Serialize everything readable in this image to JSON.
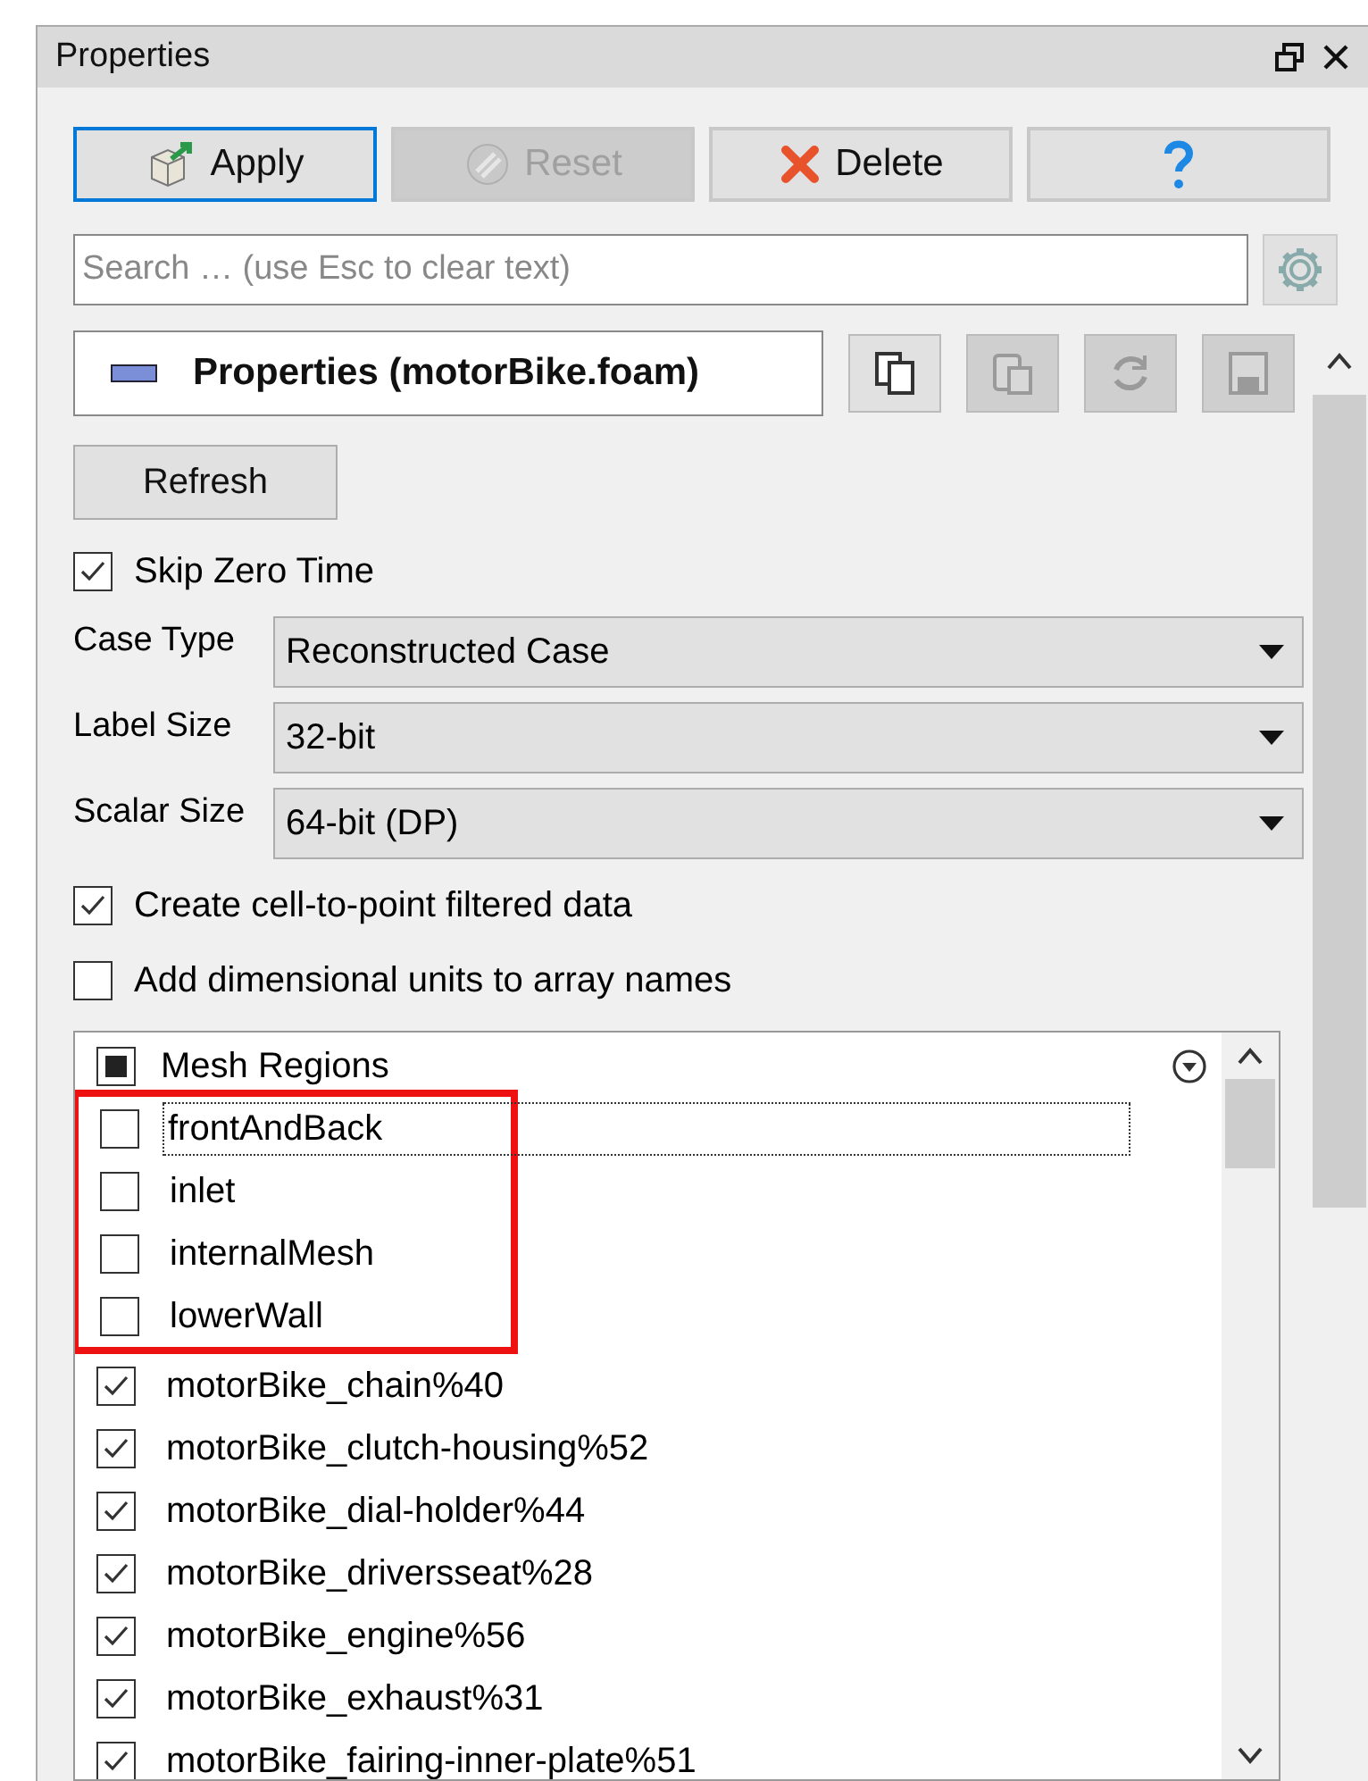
{
  "window": {
    "title": "Properties"
  },
  "actions": [
    {
      "kind": "apply",
      "label": "Apply",
      "disabled": false,
      "focused": true
    },
    {
      "kind": "reset",
      "label": "Reset",
      "disabled": true,
      "focused": false
    },
    {
      "kind": "delete",
      "label": "Delete",
      "disabled": false,
      "focused": false
    },
    {
      "kind": "help",
      "disabled": false,
      "focused": false
    }
  ],
  "search": {
    "placeholder": "Search … (use Esc to clear text)"
  },
  "section": {
    "title": "Properties (motorBike.foam)",
    "expanded": true
  },
  "tools": [
    {
      "kind": "copy",
      "disabled": false
    },
    {
      "kind": "paste",
      "disabled": true
    },
    {
      "kind": "reload",
      "disabled": true
    },
    {
      "kind": "save",
      "disabled": true
    }
  ],
  "refresh_button": "Refresh",
  "skip_zero_time": {
    "label": "Skip Zero Time",
    "checked": true
  },
  "dropdowns": [
    {
      "label": "Case Type",
      "value": "Reconstructed Case"
    },
    {
      "label": "Label Size",
      "value": "32-bit"
    },
    {
      "label": "Scalar Size",
      "value": "64-bit (DP)"
    }
  ],
  "options": [
    {
      "label": "Create cell-to-point filtered data",
      "checked": true
    },
    {
      "label": "Add dimensional units to array names",
      "checked": false
    }
  ],
  "mesh_regions": {
    "header": "Mesh Regions",
    "indeterminate": true,
    "items": [
      {
        "name": "frontAndBack",
        "checked": false,
        "focused": true,
        "highlighted": true
      },
      {
        "name": "inlet",
        "checked": false,
        "focused": false,
        "highlighted": true
      },
      {
        "name": "internalMesh",
        "checked": false,
        "focused": false,
        "highlighted": true
      },
      {
        "name": "lowerWall",
        "checked": false,
        "focused": false,
        "highlighted": true
      },
      {
        "name": "motorBike_chain%40",
        "checked": true,
        "focused": false,
        "highlighted": false
      },
      {
        "name": "motorBike_clutch-housing%52",
        "checked": true,
        "focused": false,
        "highlighted": false
      },
      {
        "name": "motorBike_dial-holder%44",
        "checked": true,
        "focused": false,
        "highlighted": false
      },
      {
        "name": "motorBike_driversseat%28",
        "checked": true,
        "focused": false,
        "highlighted": false
      },
      {
        "name": "motorBike_engine%56",
        "checked": true,
        "focused": false,
        "highlighted": false
      },
      {
        "name": "motorBike_exhaust%31",
        "checked": true,
        "focused": false,
        "highlighted": false
      },
      {
        "name": "motorBike_fairing-inner-plate%51",
        "checked": true,
        "focused": false,
        "highlighted": false
      }
    ]
  }
}
